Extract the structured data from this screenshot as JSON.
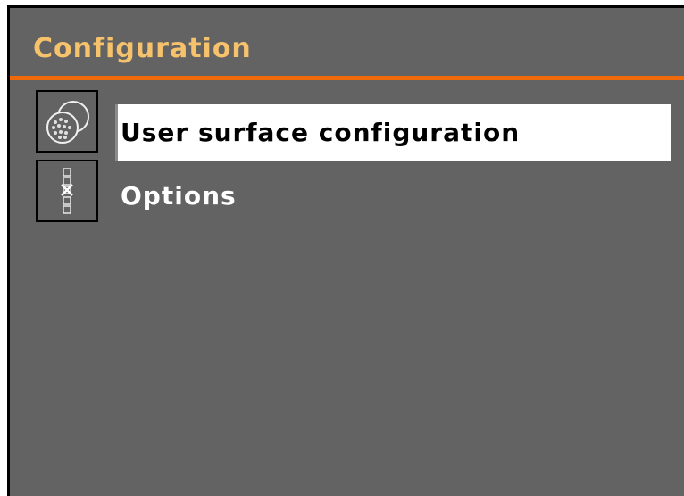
{
  "window": {
    "title": "Configuration"
  },
  "colors": {
    "background": "#636363",
    "title_text": "#f6c26b",
    "accent_rule": "#f06a0a",
    "selected_bg": "#ffffff",
    "selected_text": "#000000",
    "item_text": "#ffffff"
  },
  "menu": {
    "items": [
      {
        "label": "User surface configuration",
        "icon": "surface-config-icon",
        "selected": true
      },
      {
        "label": "Options",
        "icon": "options-icon",
        "selected": false
      }
    ]
  }
}
